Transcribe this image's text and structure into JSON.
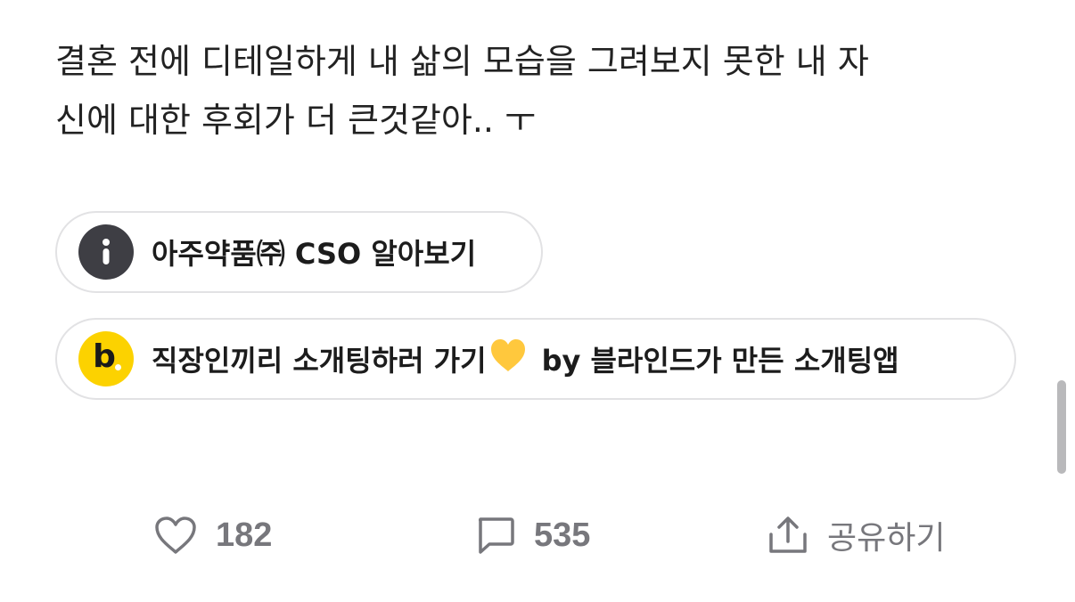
{
  "post": {
    "body": "결혼 전에 디테일하게 내 삶의 모습을 그려보지 못한 내 자\n신에 대한 후회가 더 큰것같아.. ㅜ"
  },
  "chips": [
    {
      "icon": "info-icon",
      "label": "아주약품㈜ CSO 알아보기"
    },
    {
      "icon": "blind-b-logo-icon",
      "icon_letter": "b",
      "label_before": "직장인끼리 소개팅하러 가기",
      "emoji": "yellow-heart-icon",
      "label_after": "by 블라인드가 만든 소개팅앱"
    }
  ],
  "actions": {
    "like": {
      "icon": "heart-outline-icon",
      "count": "182"
    },
    "comment": {
      "icon": "comment-bubble-icon",
      "count": "535"
    },
    "share": {
      "icon": "share-icon",
      "label": "공유하기"
    }
  },
  "colors": {
    "chip_border": "#e2e2e4",
    "info_icon_bg": "#3e3e44",
    "blind_logo_bg": "#fcd200",
    "action_gray": "#77777c",
    "heart_emoji": "#ffc83d"
  }
}
